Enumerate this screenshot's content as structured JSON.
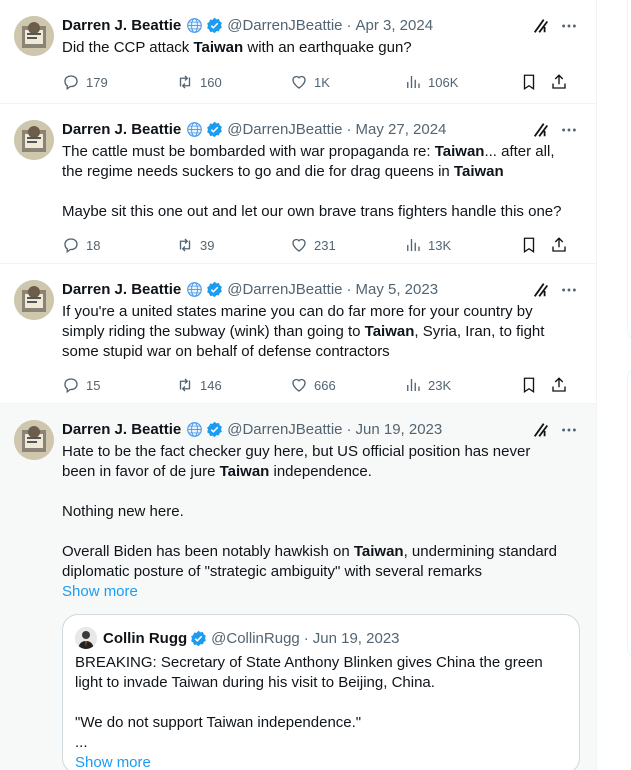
{
  "tweets": [
    {
      "name": "Darren J. Beattie",
      "handle": "@DarrenJBeattie",
      "sep": "·",
      "date": "Apr 3, 2024",
      "text_parts": [
        {
          "t": "Did the CCP attack "
        },
        {
          "t": "Taiwan",
          "b": true
        },
        {
          "t": " with an earthquake gun?"
        }
      ],
      "replies": "179",
      "reposts": "160",
      "likes": "1K",
      "views": "106K"
    },
    {
      "name": "Darren J. Beattie",
      "handle": "@DarrenJBeattie",
      "sep": "·",
      "date": "May 27, 2024",
      "text_parts": [
        {
          "t": "The cattle must be bombarded with war propaganda re: "
        },
        {
          "t": "Taiwan",
          "b": true
        },
        {
          "t": "... after all,\nthe regime needs suckers to go and die for drag queens in "
        },
        {
          "t": "Taiwan",
          "b": true
        },
        {
          "t": "\n\nMaybe sit this one out and let our own brave trans fighters handle this one?"
        }
      ],
      "replies": "18",
      "reposts": "39",
      "likes": "231",
      "views": "13K"
    },
    {
      "name": "Darren J. Beattie",
      "handle": "@DarrenJBeattie",
      "sep": "·",
      "date": "May 5, 2023",
      "text_parts": [
        {
          "t": "If you're a united states marine you can do far more for your country by\nsimply riding the subway (wink) than going to "
        },
        {
          "t": "Taiwan",
          "b": true
        },
        {
          "t": ", Syria, Iran, to fight\nsome stupid war on behalf of defense contractors"
        }
      ],
      "replies": "15",
      "reposts": "146",
      "likes": "666",
      "views": "23K"
    },
    {
      "name": "Darren J. Beattie",
      "handle": "@DarrenJBeattie",
      "sep": "·",
      "date": "Jun 19, 2023",
      "text_parts": [
        {
          "t": "Hate to be the fact checker guy here, but US official position has never\nbeen in favor of de jure "
        },
        {
          "t": "Taiwan",
          "b": true
        },
        {
          "t": " independence.\n\nNothing new here.\n\nOverall Biden has been notably hawkish on "
        },
        {
          "t": "Taiwan",
          "b": true
        },
        {
          "t": ", undermining standard\ndiplomatic posture of \"strategic ambiguity\" with several remarks"
        }
      ],
      "show_more": "Show more",
      "quote": {
        "name": "Collin Rugg",
        "handle": "@CollinRugg",
        "sep": "·",
        "date": "Jun 19, 2023",
        "text": "BREAKING: Secretary of State Anthony Blinken gives China the green\nlight to invade Taiwan during his visit to Beijing, China.\n\n\"We do not support Taiwan independence.\"\n...",
        "show_more": "Show more"
      }
    }
  ],
  "colors": {
    "accent": "#1d9bf0",
    "muted": "#536471",
    "text": "#0f1419",
    "border": "#eff3f4"
  },
  "icons": [
    "globe-icon",
    "verified-badge-icon",
    "grok-icon",
    "more-icon",
    "reply-icon",
    "repost-icon",
    "like-icon",
    "views-icon",
    "bookmark-icon",
    "share-icon"
  ]
}
